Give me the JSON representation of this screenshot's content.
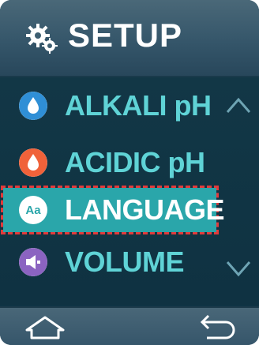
{
  "header": {
    "title": "SETUP",
    "icon": "gear-icon"
  },
  "menu": {
    "items": [
      {
        "label": "ALKALI pH",
        "icon": "water-drop-icon",
        "icon_color": "#2f8fd6"
      },
      {
        "label": "ACIDIC pH",
        "icon": "water-drop-icon",
        "icon_color": "#f0623a"
      },
      {
        "label": "LANGUAGE",
        "icon": "language-icon",
        "icon_color": "#2aa6aa",
        "icon_text": "Aa"
      },
      {
        "label": "VOLUME",
        "icon": "speaker-icon",
        "icon_color": "#8b63c1"
      }
    ],
    "selected_index": 2
  },
  "nav": {
    "up": "chevron-up-icon",
    "down": "chevron-down-icon",
    "home": "home-icon",
    "back": "back-icon"
  },
  "colors": {
    "accent": "#2aa6aa",
    "label": "#5fd3d6",
    "highlight_outline": "#e23b3b"
  }
}
